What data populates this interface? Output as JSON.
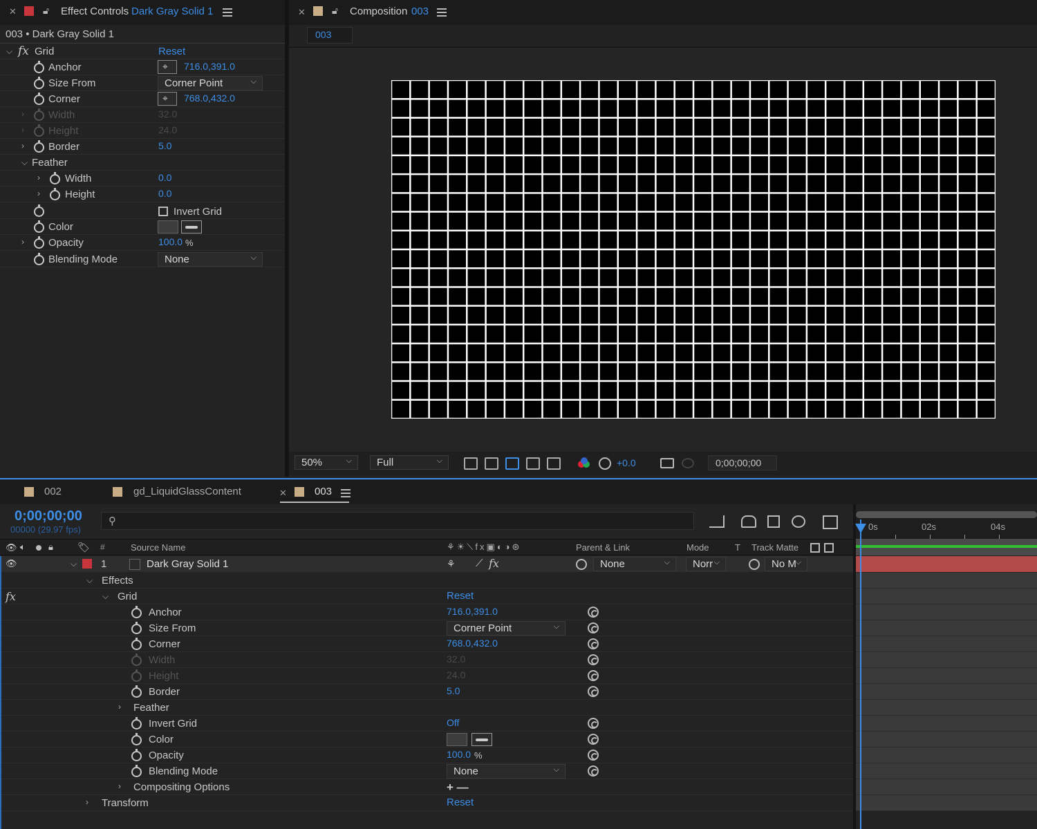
{
  "effect_controls": {
    "tab_prefix": "Effect Controls",
    "tab_layer": "Dark Gray Solid 1",
    "breadcrumb": "003 • Dark Gray Solid 1",
    "effect_name": "Grid",
    "reset": "Reset",
    "props": {
      "anchor": {
        "label": "Anchor",
        "value": "716.0,391.0"
      },
      "size_from": {
        "label": "Size From",
        "value": "Corner Point"
      },
      "corner": {
        "label": "Corner",
        "value": "768.0,432.0"
      },
      "width": {
        "label": "Width",
        "value": "32.0"
      },
      "height": {
        "label": "Height",
        "value": "24.0"
      },
      "border": {
        "label": "Border",
        "value": "5.0"
      },
      "feather": {
        "label": "Feather"
      },
      "feather_width": {
        "label": "Width",
        "value": "0.0"
      },
      "feather_height": {
        "label": "Height",
        "value": "0.0"
      },
      "invert": {
        "label": "Invert Grid"
      },
      "color": {
        "label": "Color",
        "swatch": "#3c3c3c"
      },
      "opacity": {
        "label": "Opacity",
        "value": "100.0",
        "unit": "%"
      },
      "blending": {
        "label": "Blending Mode",
        "value": "None"
      }
    }
  },
  "composition": {
    "tab_prefix": "Composition",
    "tab_name": "003",
    "subtab": "003",
    "zoom": "50%",
    "resolution": "Full",
    "exposure": "+0.0",
    "timecode": "0;00;00;00",
    "grid": {
      "cols": 32,
      "rows": 18,
      "line_color": "#ffffff",
      "bg_color": "#000000"
    }
  },
  "timeline": {
    "tabs": [
      {
        "label": "002"
      },
      {
        "label": "gd_LiquidGlassContent"
      },
      {
        "label": "003",
        "active": true
      }
    ],
    "timecode": "0;00;00;00",
    "frame_info": "00000 (29.97 fps)",
    "columns": {
      "num": "#",
      "source": "Source Name",
      "parent": "Parent & Link",
      "mode": "Mode",
      "t": "T",
      "matte": "Track Matte"
    },
    "layer": {
      "num": "1",
      "name": "Dark Gray Solid 1",
      "parent": "None",
      "mode": "Norr",
      "matte": "No M"
    },
    "effects_label": "Effects",
    "grid_label": "Grid",
    "reset": "Reset",
    "props": {
      "anchor": {
        "label": "Anchor",
        "value": "716.0,391.0"
      },
      "size_from": {
        "label": "Size From",
        "value": "Corner Point"
      },
      "corner": {
        "label": "Corner",
        "value": "768.0,432.0"
      },
      "width": {
        "label": "Width",
        "value": "32.0"
      },
      "height": {
        "label": "Height",
        "value": "24.0"
      },
      "border": {
        "label": "Border",
        "value": "5.0"
      },
      "feather": {
        "label": "Feather"
      },
      "invert": {
        "label": "Invert Grid",
        "value": "Off"
      },
      "color": {
        "label": "Color"
      },
      "opacity": {
        "label": "Opacity",
        "value": "100.0",
        "unit": "%"
      },
      "blending": {
        "label": "Blending Mode",
        "value": "None"
      },
      "compositing": {
        "label": "Compositing Options",
        "value": "+ —"
      }
    },
    "transform_label": "Transform",
    "ruler": [
      "0s",
      "02s",
      "04s"
    ],
    "layer_bar_color": "#b34a4a",
    "work_area_color": "#2fbf2f"
  }
}
